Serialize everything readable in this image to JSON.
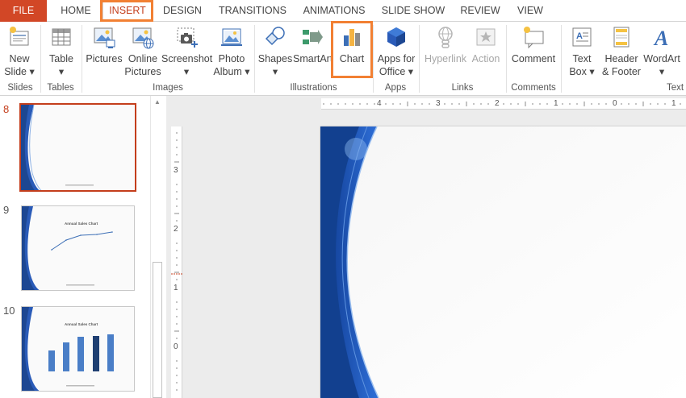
{
  "tabs": [
    {
      "label": "FILE"
    },
    {
      "label": "HOME"
    },
    {
      "label": "INSERT"
    },
    {
      "label": "DESIGN"
    },
    {
      "label": "TRANSITIONS"
    },
    {
      "label": "ANIMATIONS"
    },
    {
      "label": "SLIDE SHOW"
    },
    {
      "label": "REVIEW"
    },
    {
      "label": "VIEW"
    }
  ],
  "ribbon": {
    "buttons": {
      "new_slide": "New Slide ▾",
      "new_slide_1": "New",
      "new_slide_2": "Slide ▾",
      "table_1": "Table",
      "table_2": "▾",
      "pictures": "Pictures",
      "online_pictures_1": "Online",
      "online_pictures_2": "Pictures",
      "screenshot_1": "Screenshot",
      "screenshot_2": "▾",
      "photo_album_1": "Photo",
      "photo_album_2": "Album ▾",
      "shapes_1": "Shapes",
      "shapes_2": "▾",
      "smartart": "SmartArt",
      "chart": "Chart",
      "apps_1": "Apps for",
      "apps_2": "Office ▾",
      "hyperlink": "Hyperlink",
      "action": "Action",
      "comment": "Comment",
      "text_box_1": "Text",
      "text_box_2": "Box ▾",
      "header_footer_1": "Header",
      "header_footer_2": "& Footer",
      "wordart_1": "WordArt",
      "wordart_2": "▾"
    },
    "groups": {
      "slides": "Slides",
      "tables": "Tables",
      "images": "Images",
      "illustrations": "Illustrations",
      "apps": "Apps",
      "links": "Links",
      "comments": "Comments",
      "text": "Text"
    }
  },
  "slides_panel": {
    "slides": [
      {
        "number": "8",
        "selected": true
      },
      {
        "number": "9",
        "title": "Annual Sales Chart",
        "type": "line"
      },
      {
        "number": "10",
        "title": "Annual Sales Chart",
        "type": "bar"
      }
    ]
  },
  "rulers": {
    "horizontal": [
      "4",
      "3",
      "2",
      "1",
      "0",
      "1"
    ],
    "vertical": [
      "3",
      "2",
      "1",
      "0"
    ]
  },
  "colors": {
    "file_tab": "#d24726",
    "active_tab_text": "#c43e1c",
    "highlight": "#f28033",
    "slide_accent": "#2a5bb8"
  }
}
